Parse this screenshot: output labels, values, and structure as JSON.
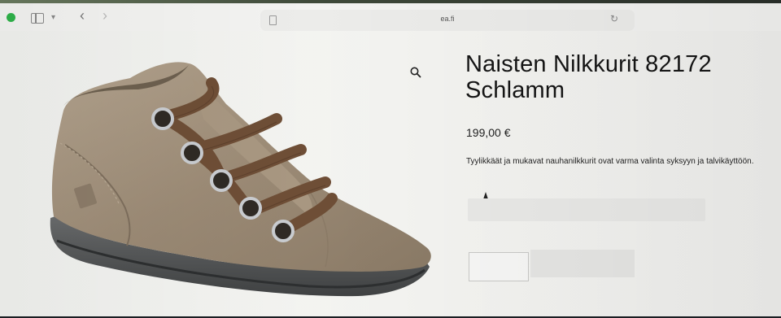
{
  "browser": {
    "address": "ea.fi",
    "icons": {
      "sidebar": "sidebar-icon",
      "chevron": "chevron-down-icon",
      "back": "back-arrow-icon",
      "forward": "forward-arrow-icon",
      "reader": "reader-icon",
      "reload": "reload-icon"
    }
  },
  "product": {
    "title_line1": "Naisten Nilkkurit 82172",
    "title_line2": "Schlamm",
    "price": "199,00 €",
    "description": "Tyylikkäät ja mukavat nauhanilkkurit ovat varma valinta syksyyn ja talvikäyttöön.",
    "zoom_icon": "magnifier-icon"
  },
  "colors": {
    "accent_green": "#2fb34a",
    "shoe_suede": "#9a8a76",
    "laces": "#6e4e36",
    "sole": "#56585a"
  }
}
